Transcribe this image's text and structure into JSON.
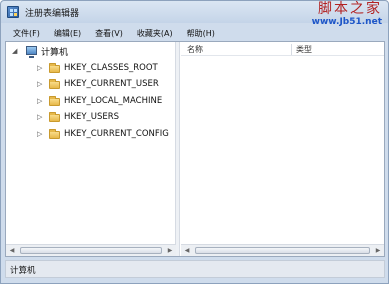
{
  "window": {
    "title": "注册表编辑器",
    "watermark_name": "脚本之家",
    "watermark_url": "www.Jb51.net"
  },
  "menu": [
    {
      "label": "文件(F)"
    },
    {
      "label": "编辑(E)"
    },
    {
      "label": "查看(V)"
    },
    {
      "label": "收藏夹(A)"
    },
    {
      "label": "帮助(H)"
    }
  ],
  "tree": {
    "root": {
      "label": "计算机",
      "icon": "computer-icon",
      "expanded": true,
      "selected": true
    },
    "hives": [
      {
        "label": "HKEY_CLASSES_ROOT",
        "icon": "folder-icon"
      },
      {
        "label": "HKEY_CURRENT_USER",
        "icon": "folder-icon"
      },
      {
        "label": "HKEY_LOCAL_MACHINE",
        "icon": "folder-icon"
      },
      {
        "label": "HKEY_USERS",
        "icon": "folder-icon"
      },
      {
        "label": "HKEY_CURRENT_CONFIG",
        "icon": "folder-icon"
      }
    ]
  },
  "list": {
    "columns": {
      "name": "名称",
      "type": "类型"
    }
  },
  "status": {
    "text": "计算机"
  },
  "colors": {
    "window_frame": "#cfdcec",
    "folder": "#e6b84a",
    "watermark_name": "#b22222",
    "watermark_url": "#1e56c8"
  }
}
